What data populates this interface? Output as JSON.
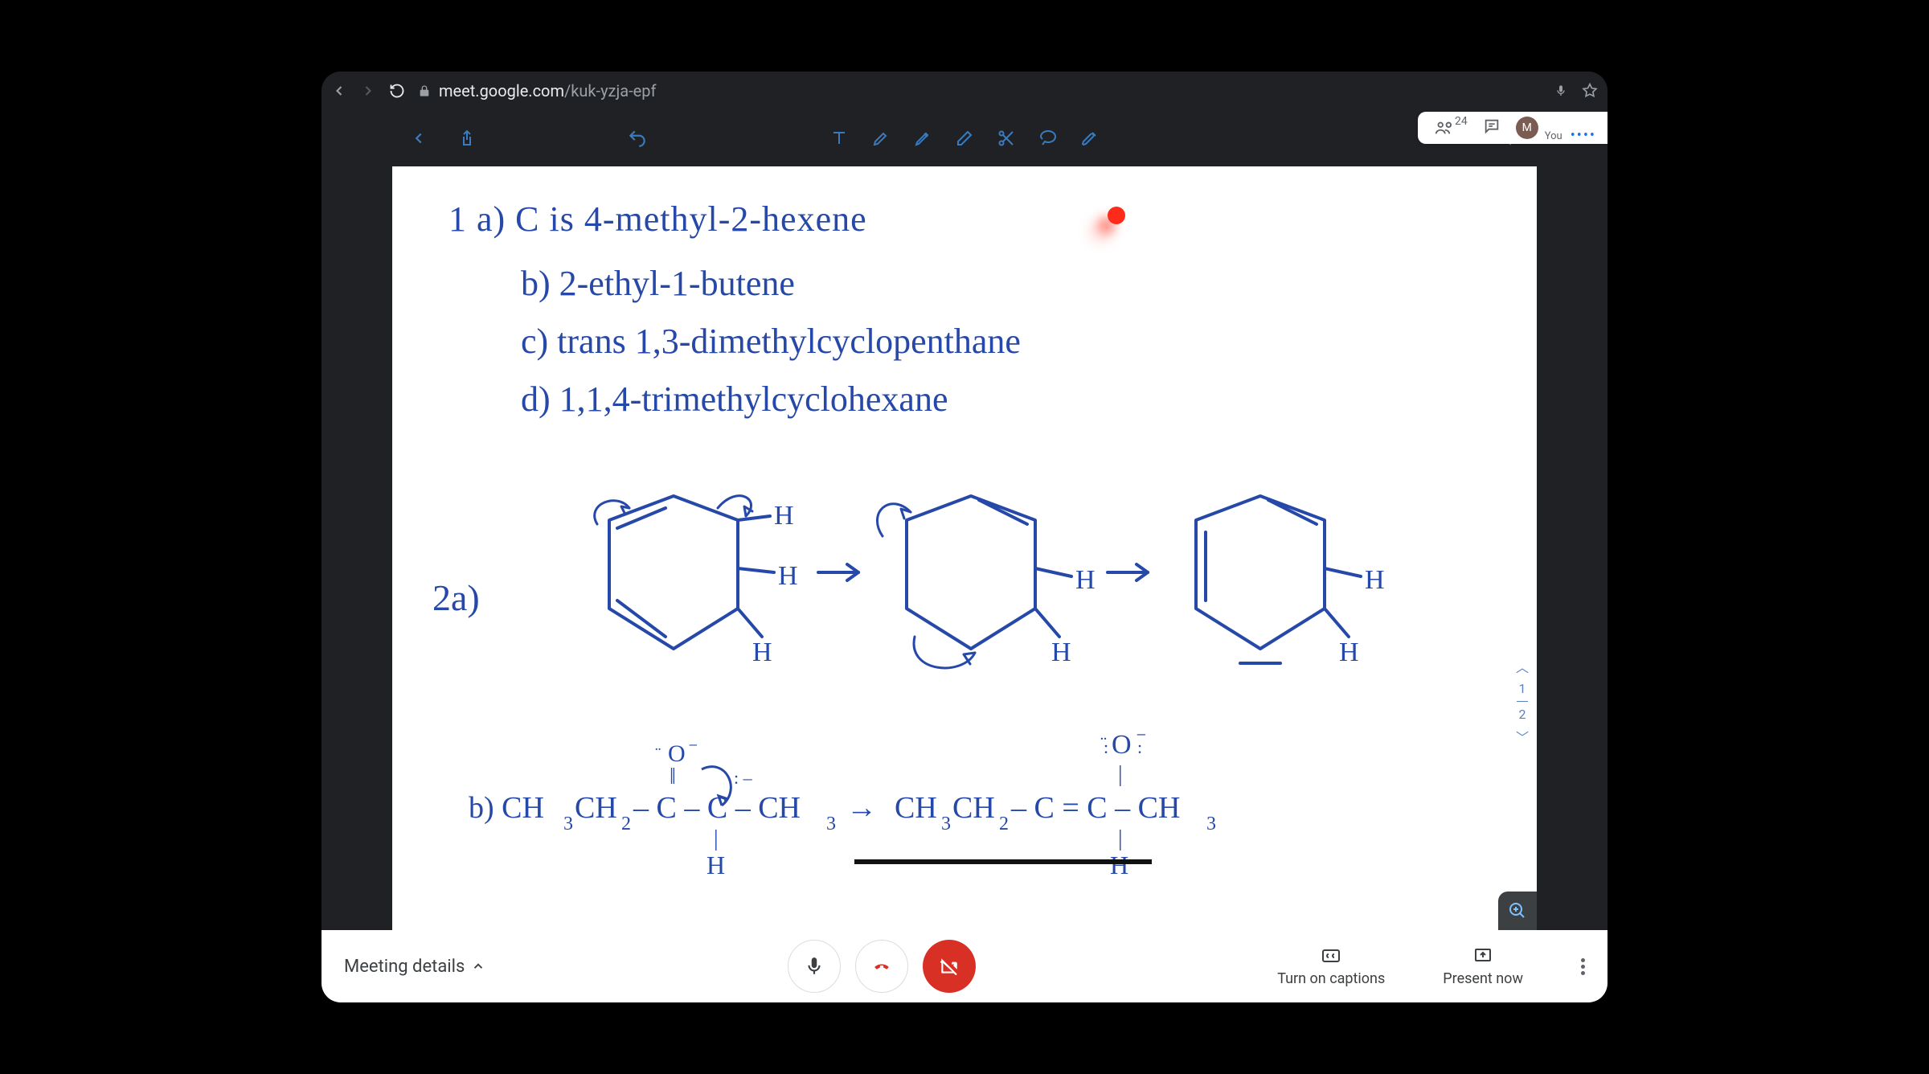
{
  "browser": {
    "url_host": "meet.google.com",
    "url_path": "/kuk-yzja-epf"
  },
  "participant_pill": {
    "count": "24",
    "you_label": "You",
    "avatar_letter": "M"
  },
  "whiteboard": {
    "q1a": "1   a)  C  is  4-methyl-2-hexene",
    "q1b": "b) 2-ethyl-1-butene",
    "q1c": "c) trans 1,3-dimethylcyclopenthane",
    "q1d": "d)  1,1,4-trimethylcyclohexane",
    "q2a_label": "2a)",
    "q2b_prefix": "b)  CH",
    "page_current": "1",
    "page_total": "2"
  },
  "footer": {
    "meeting_details": "Meeting details",
    "captions": "Turn on captions",
    "present": "Present now"
  }
}
